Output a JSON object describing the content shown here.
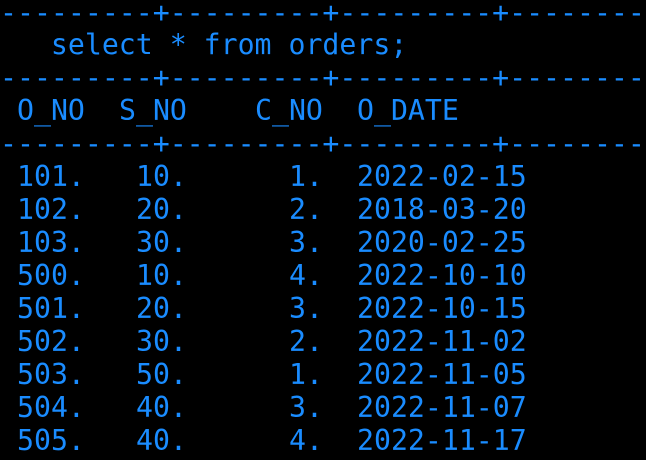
{
  "terminal": {
    "text_color": "#1a8cff",
    "background": "#000000",
    "separator_top": "---------+---------+---------+--------",
    "command": "   select * from orders;",
    "separator_mid": "---------+---------+---------+--------",
    "headers": [
      "O_NO",
      "S_NO",
      "C_NO",
      "O_DATE"
    ],
    "separator_after_header": "---------+---------+---------+--------",
    "rows": [
      [
        "101.",
        "10.",
        "1.",
        "2022-02-15"
      ],
      [
        "102.",
        "20.",
        "2.",
        "2018-03-20"
      ],
      [
        "103.",
        "30.",
        "3.",
        "2020-02-25"
      ],
      [
        "500.",
        "10.",
        "4.",
        "2022-10-10"
      ],
      [
        "501.",
        "20.",
        "3.",
        "2022-10-15"
      ],
      [
        "502.",
        "30.",
        "2.",
        "2022-11-02"
      ],
      [
        "503.",
        "50.",
        "1.",
        "2022-11-05"
      ],
      [
        "504.",
        "40.",
        "3.",
        "2022-11-07"
      ],
      [
        "505.",
        "40.",
        "4.",
        "2022-11-17"
      ]
    ]
  }
}
